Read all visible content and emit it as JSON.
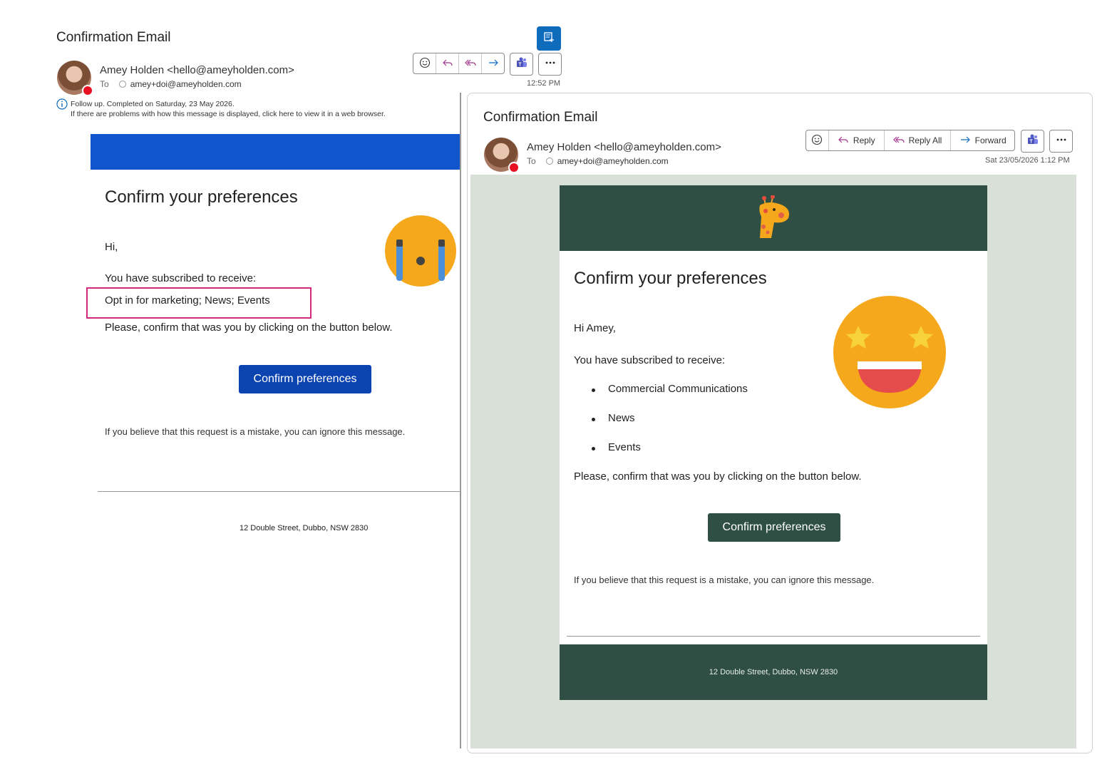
{
  "left": {
    "subject": "Confirmation Email",
    "from": "Amey Holden <hello@ameyholden.com>",
    "to_label": "To",
    "to_address": "amey+doi@ameyholden.com",
    "time": "12:52 PM",
    "followup": "Follow up.  Completed on Saturday, 23 May 2026.",
    "display_notice": "If there are problems with how this message is displayed, click here to view it in a web browser.",
    "heading": "Confirm your preferences",
    "greeting": "Hi,",
    "subscribed_intro": "You have subscribed to receive:",
    "subscriptions_inline": "Opt in for marketing; News; Events",
    "confirm_instruction": "Please, confirm that was you by clicking on the button below.",
    "button_label": "Confirm preferences",
    "ignore_text": "If you believe that this request is a mistake, you can ignore this message.",
    "address": "12 Double Street, Dubbo, NSW 2830",
    "colors": {
      "banner": "#1155cc",
      "button": "#0b44b0",
      "highlight": "#d12a7e"
    },
    "emoji": "crying-face-icon"
  },
  "right": {
    "subject": "Confirmation Email",
    "from": "Amey Holden <hello@ameyholden.com>",
    "to_label": "To",
    "to_address": "amey+doi@ameyholden.com",
    "datetime": "Sat 23/05/2026 1:12 PM",
    "actions": {
      "reply": "Reply",
      "reply_all": "Reply All",
      "forward": "Forward"
    },
    "heading": "Confirm your preferences",
    "greeting": "Hi Amey,",
    "subscribed_intro": "You have subscribed to receive:",
    "subscriptions": [
      "Commercial Communications",
      "News",
      "Events"
    ],
    "confirm_instruction": "Please, confirm that was you by clicking on the button below.",
    "button_label": "Confirm preferences",
    "ignore_text": "If you believe that this request is a mistake, you can ignore this message.",
    "address": "12 Double Street, Dubbo, NSW 2830",
    "colors": {
      "header": "#2f4f45",
      "background": "#d8e0d8",
      "button": "#2f4f45"
    },
    "logo": "giraffe-icon",
    "emoji": "star-struck-face-icon"
  }
}
